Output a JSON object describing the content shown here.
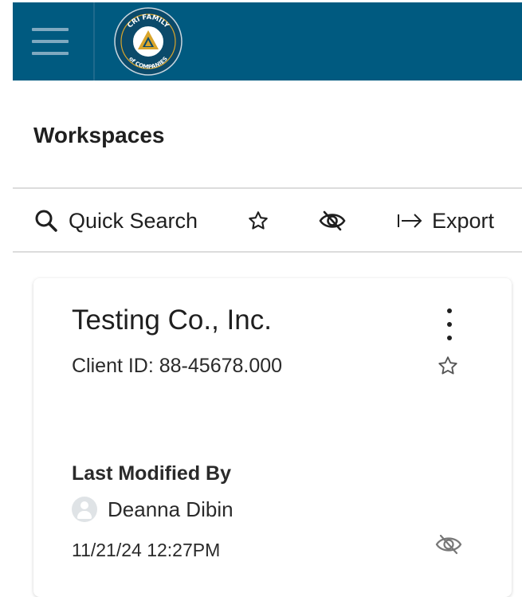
{
  "header": {
    "menu_icon": "hamburger-menu-icon",
    "logo": {
      "name": "cri-family-of-companies-logo",
      "text_top": "CRI FAMILY",
      "text_bottom": "of COMPANIES"
    },
    "colors": {
      "bar": "#005a80",
      "menu_icon": "#7fa9c0",
      "logo_gold": "#d9a52b"
    }
  },
  "page": {
    "title": "Workspaces"
  },
  "toolbar": {
    "search_label": "Quick Search",
    "search_icon": "search-icon",
    "favorites_icon": "star-outline-icon",
    "hidden_icon": "eye-slash-icon",
    "export_label": "Export",
    "export_icon": "arrow-right-to-bar-icon"
  },
  "workspace_card": {
    "name": "Testing Co., Inc.",
    "client_id": "Client ID: 88-45678.000",
    "menu_icon": "more-vertical-icon",
    "favorite_icon": "star-outline-icon",
    "last_modified_heading": "Last Modified By",
    "modified_by": "Deanna Dibin",
    "avatar_icon": "user-avatar-icon",
    "modified_at": "11/21/24 12:27PM",
    "visibility_icon": "eye-slash-icon"
  }
}
